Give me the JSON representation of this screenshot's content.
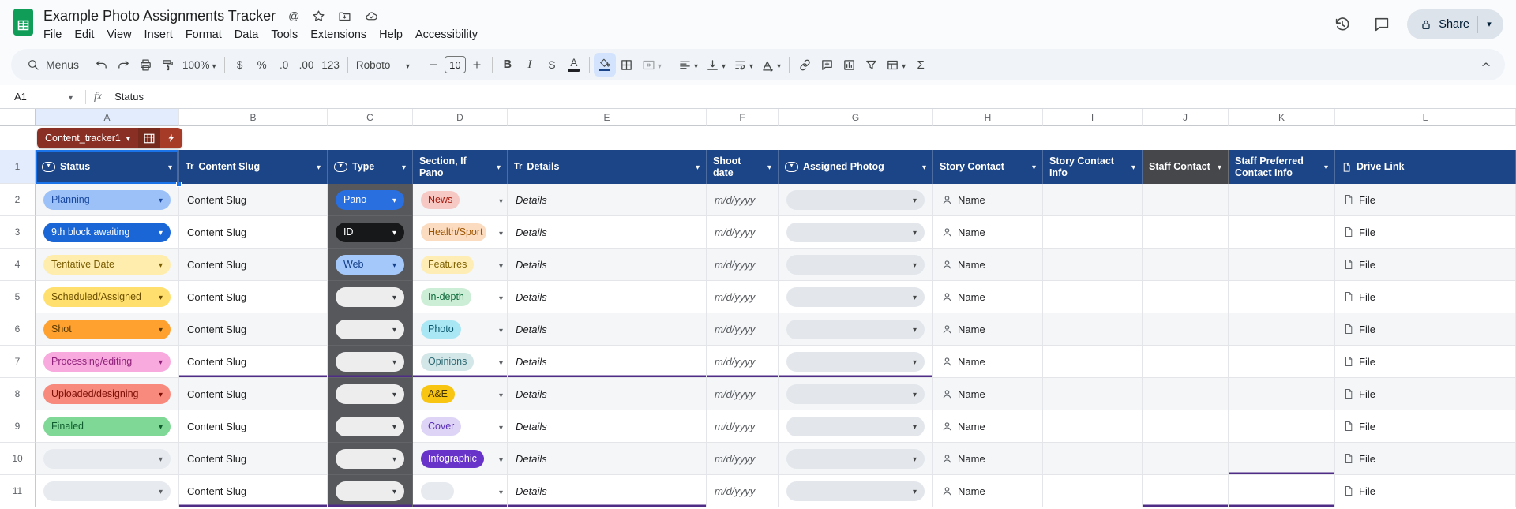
{
  "titlebar": {
    "title": "Example Photo Assignments Tracker",
    "menus": [
      "File",
      "Edit",
      "View",
      "Insert",
      "Format",
      "Data",
      "Tools",
      "Extensions",
      "Help",
      "Accessibility"
    ],
    "share": "Share"
  },
  "toolbar": {
    "menus_label": "Menus",
    "zoom": "100%",
    "currency": "$",
    "percent": "%",
    "decimal_decrease": ".0",
    "decimal_increase": ".00",
    "more_formats": "123",
    "font": "Roboto",
    "font_size": "10",
    "bold": "B",
    "italic": "I",
    "strikethrough": "S",
    "text_color": "A",
    "functions": "Σ"
  },
  "formula_bar": {
    "cell_ref": "A1",
    "fx_label": "fx",
    "value": "Status"
  },
  "sheet": {
    "table_chip": "Content_tracker1",
    "column_letters": [
      "A",
      "B",
      "C",
      "D",
      "E",
      "F",
      "G",
      "H",
      "I",
      "J",
      "K",
      "L"
    ],
    "row_labels": [
      "1",
      "2",
      "3",
      "4",
      "5",
      "6",
      "7",
      "8",
      "9",
      "10",
      "11"
    ],
    "icons": {
      "text_type": "Tr",
      "at": "@"
    },
    "headers": [
      {
        "label": "Status"
      },
      {
        "label": "Content Slug"
      },
      {
        "label": "Type"
      },
      {
        "label": "Section, If Pano"
      },
      {
        "label": "Details"
      },
      {
        "label": "Shoot date"
      },
      {
        "label": "Assigned Photog"
      },
      {
        "label": "Story Contact"
      },
      {
        "label": "Story Contact Info"
      },
      {
        "label": "Staff Contact"
      },
      {
        "label": "Staff Preferred Contact Info"
      },
      {
        "label": "Drive Link"
      }
    ],
    "cells": {
      "content_slug": "Content Slug",
      "details": "Details",
      "shoot_date": "m/d/yyyy",
      "contact_name": "Name",
      "drive_file": "File"
    },
    "rows": [
      {
        "status": {
          "label": "Planning",
          "bg": "#9cc1f9",
          "fg": "#19489e"
        },
        "type": {
          "label": "Pano",
          "bg": "#2a6fe0",
          "fg": "#ffffff"
        },
        "section": {
          "label": "News",
          "bg": "#f6c9c5",
          "fg": "#a61c0f"
        }
      },
      {
        "status": {
          "label": "9th block awaiting",
          "bg": "#1a66d6",
          "fg": "#ffffff"
        },
        "type": {
          "label": "ID",
          "bg": "#17181a",
          "fg": "#ffffff"
        },
        "section": {
          "label": "Health/Sport",
          "bg": "#fbdcc0",
          "fg": "#9c5400"
        }
      },
      {
        "status": {
          "label": "Tentative Date",
          "bg": "#ffedae",
          "fg": "#7a5c00"
        },
        "type": {
          "label": "Web",
          "bg": "#a5c8fa",
          "fg": "#123f8c"
        },
        "section": {
          "label": "Features",
          "bg": "#feeeb5",
          "fg": "#7f6000"
        }
      },
      {
        "status": {
          "label": "Scheduled/Assigned",
          "bg": "#ffe06e",
          "fg": "#6b4e00"
        },
        "type": null,
        "section": {
          "label": "In-depth",
          "bg": "#cdeed6",
          "fg": "#0f6b3c"
        }
      },
      {
        "status": {
          "label": "Shot",
          "bg": "#ffa12f",
          "fg": "#5b3a00"
        },
        "type": null,
        "section": {
          "label": "Photo",
          "bg": "#a9e7f5",
          "fg": "#0d5a6e"
        }
      },
      {
        "status": {
          "label": "Processing/editing",
          "bg": "#f8a9de",
          "fg": "#8e2079"
        },
        "type": null,
        "section": {
          "label": "Opinions",
          "bg": "#d3e6e8",
          "fg": "#2e6b74"
        }
      },
      {
        "status": {
          "label": "Uploaded/designing",
          "bg": "#f8897d",
          "fg": "#7c1007"
        },
        "type": null,
        "section": {
          "label": "A&E",
          "bg": "#f9c513",
          "fg": "#433300"
        }
      },
      {
        "status": {
          "label": "Finaled",
          "bg": "#7fd895",
          "fg": "#0f5c2e"
        },
        "type": null,
        "section": {
          "label": "Cover",
          "bg": "#ded5f6",
          "fg": "#5a30b5"
        }
      },
      {
        "status": null,
        "type": null,
        "section": {
          "label": "Infographic",
          "bg": "#6733c9",
          "fg": "#ffffff"
        }
      },
      {
        "status": null,
        "type": null,
        "section": null
      }
    ]
  },
  "colors": {
    "header_bg": "#1c4587",
    "staff_header_bg": "#45474b",
    "type_col_bg": "#56585b",
    "selection": "#1a73e8",
    "band": "#f4f6f8",
    "purple_border": "#4f2d87",
    "chip_red": "#8a2f23",
    "chip_red_mid": "#762a1e",
    "chip_red_bolt": "#a63c28",
    "share_bg": "#dde3ea"
  }
}
